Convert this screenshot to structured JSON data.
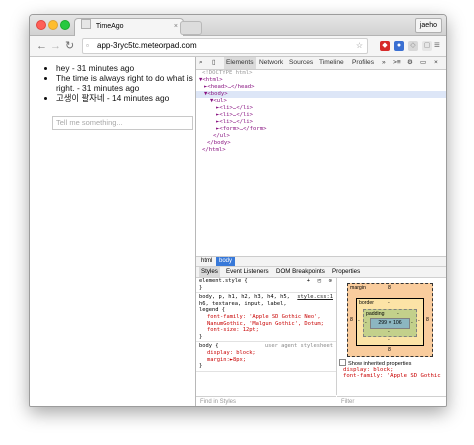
{
  "colors": {
    "close": "#ff5f57",
    "minimize": "#ffbd2e",
    "zoom": "#28c940",
    "accent": "#3879d9"
  },
  "tab": {
    "title": "TimeAgo"
  },
  "user_button": "jaeho",
  "address": {
    "url": "app-3ryc5tc.meteorpad.com"
  },
  "page": {
    "items": [
      "hey - 31 minutes ago",
      "The time is always right to do what is right. - 31 minutes ago",
      "고생이 팔자네 - 14 minutes ago"
    ],
    "input_placeholder": "Tell me something..."
  },
  "devtools": {
    "tabs": [
      "Elements",
      "Network",
      "Sources",
      "Timeline",
      "Profiles"
    ],
    "tree": [
      "<!DOCTYPE html>",
      "▼<html>",
      "►<head>…</head>",
      "▼<body>",
      "▼<ul>",
      "►<li>…</li>",
      "►<li>…</li>",
      "►<li>…</li>",
      "►<form>…</form>",
      "</ul>",
      "</body>",
      "</html>"
    ],
    "breadcrumbs": [
      "html",
      "body"
    ],
    "subtabs": [
      "Styles",
      "Event Listeners",
      "DOM Breakpoints",
      "Properties"
    ],
    "styles": {
      "element_style": "element.style {",
      "rule1_selector": "body, p, h1, h2, h3, h4, h5, h6, textarea, input, label, legend {",
      "rule1_source": "style.css:1",
      "rule1_prop1": "font-family: 'Apple SD Gothic Neo', NanumGothic, 'Malgun Gothic', Dotum;",
      "rule1_prop2": "font-size: 12pt;",
      "rule2_selector": "body {",
      "rule2_source": "user agent stylesheet",
      "rule2_prop1": "display: block;",
      "rule2_prop2": "margin:►8px;",
      "close_brace": "}",
      "find_placeholder": "Find in Styles"
    },
    "boxmodel": {
      "margin_label": "margin",
      "border_label": "border",
      "padding_label": "padding",
      "dash": "-",
      "margin_value": "8",
      "content": "299 × 106",
      "show_inherited": "Show inherited properties",
      "inherited_prop1": "display: block;",
      "inherited_prop2": "font-family: 'Apple SD Gothic",
      "filter_placeholder": "Filter"
    }
  }
}
